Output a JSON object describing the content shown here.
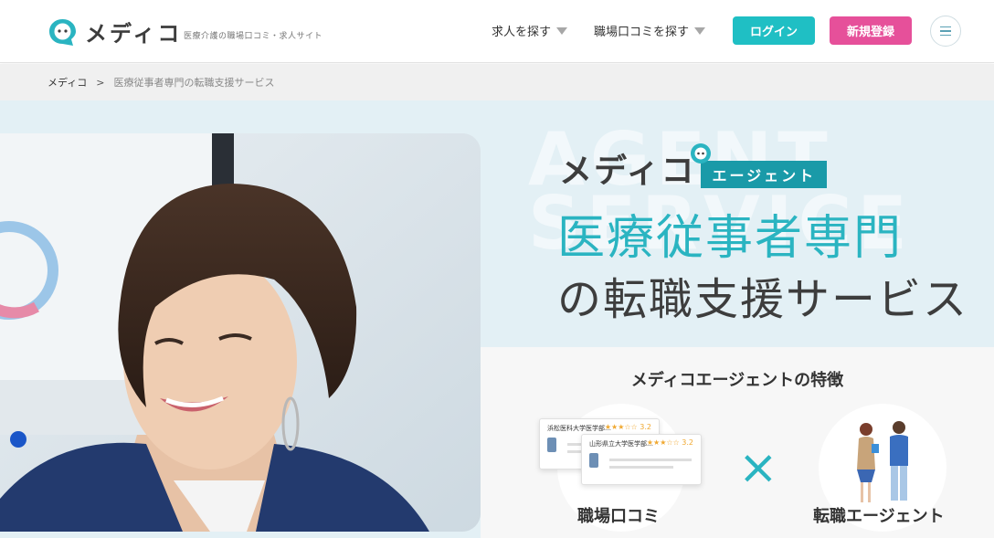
{
  "header": {
    "logo_text": "メディコ",
    "tagline": "医療介護の職場口コミ・求人サイト",
    "nav": [
      {
        "label": "求人を探す"
      },
      {
        "label": "職場口コミを探す"
      }
    ],
    "login_label": "ログイン",
    "signup_label": "新規登録",
    "menu_icon": "hamburger-icon"
  },
  "breadcrumb": {
    "home": "メディコ",
    "separator": ">",
    "current": "医療従事者専門の転職支援サービス"
  },
  "hero": {
    "watermark_line1": "AGENT",
    "watermark_line2": "SERVICE",
    "logo_text": "メディコ",
    "badge": "エージェント",
    "headline1": "医療従事者専門",
    "headline2": "の転職支援サービス",
    "photo_icon": "woman-smiling-photo"
  },
  "features": {
    "title": "メディコエージェントの特徴",
    "left_label": "職場口コミ",
    "right_label": "転職エージェント",
    "cross_symbol": "×",
    "cards": [
      {
        "title": "浜松医科大学医学部…",
        "stars": "★★★☆☆",
        "rating": "3.2"
      },
      {
        "title": "山形県立大学医学部…",
        "stars": "★★★☆☆",
        "rating": "3.2"
      }
    ]
  },
  "colors": {
    "accent": "#1fbfc4",
    "signup": "#e6509a",
    "headline": "#2ab4c1",
    "badge": "#1a9aa8",
    "hero_bg": "#e3f0f5"
  }
}
